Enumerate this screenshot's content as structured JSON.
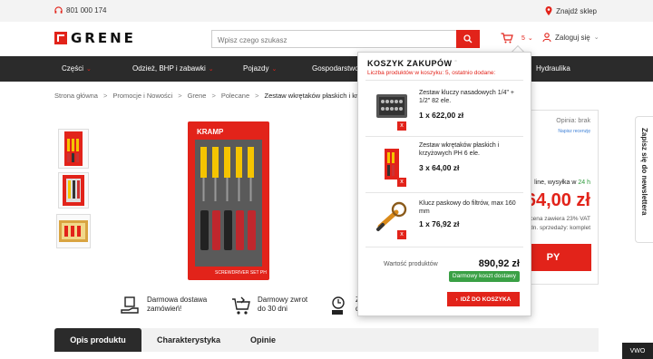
{
  "topbar": {
    "phone": "801 000 174",
    "store": "Znajdź sklep"
  },
  "header": {
    "logo_text": "GRENE",
    "search_placeholder": "Wpisz czego szukasz",
    "cart_count": "5",
    "login_label": "Zaloguj się"
  },
  "nav": {
    "items": [
      {
        "label": "Części"
      },
      {
        "label": "Odzież, BHP i zabawki"
      },
      {
        "label": "Pojazdy"
      },
      {
        "label": "Gospodarstwo"
      },
      {
        "label": "Hydraulika"
      }
    ]
  },
  "breadcrumb": [
    {
      "label": "Strona główna"
    },
    {
      "label": "Promocje i Nowości"
    },
    {
      "label": "Grene"
    },
    {
      "label": "Polecane"
    },
    {
      "label": "Zestaw wkrętaków płaskich i krzyżow"
    }
  ],
  "product": {
    "image_brand": "KRAMP",
    "image_caption": "SCREWDRIVER SET PH"
  },
  "pricebox": {
    "opinie": "Opinia: brak",
    "write_review": "Napisz recenzję",
    "shipping_prefix": "line, wysyłka w",
    "shipping_hl": "24 h",
    "price": "64,00 zł",
    "vat": "cena zawiera 23% VAT",
    "unit": "Jedn. sprzedaży: komplet",
    "buy_label": "PY"
  },
  "newsletter": {
    "label": "Zapisz się do newslettera"
  },
  "features": [
    {
      "line1": "Darmowa dostawa",
      "line2": "zamówień!"
    },
    {
      "line1": "Darmowy zwrot",
      "line2": "do 30 dni"
    },
    {
      "line1": "Z",
      "line2": "d"
    }
  ],
  "tabs": [
    {
      "label": "Opis produktu"
    },
    {
      "label": "Charakterystyka"
    },
    {
      "label": "Opinie"
    }
  ],
  "cart_popup": {
    "title": "KOSZYK ZAKUPÓW",
    "subtitle": "Liczba produktów w koszyku: 5, ostatnio dodane:",
    "items": [
      {
        "name": "Zestaw kluczy nasadowych 1/4\" + 1/2\" 82 ele.",
        "qty": "1 x 622,00 zł"
      },
      {
        "name": "Zestaw wkrętaków płaskich i krzyżowych PH 6 ele.",
        "qty": "3 x 64,00 zł"
      },
      {
        "name": "Klucz paskowy do filtrów, max 160 mm",
        "qty": "1 x 76,92 zł"
      }
    ],
    "total_label": "Wartość produktów",
    "total": "890,92 zł",
    "free_shipping": "Darmowy koszt dostawy",
    "go_button": "IDŹ DO KOSZYKA",
    "remove_icon": "x"
  },
  "badge": {
    "vwo": "VWO"
  },
  "colors": {
    "accent": "#e2231a",
    "dark": "#2b2b2b",
    "green": "#3aa045"
  }
}
